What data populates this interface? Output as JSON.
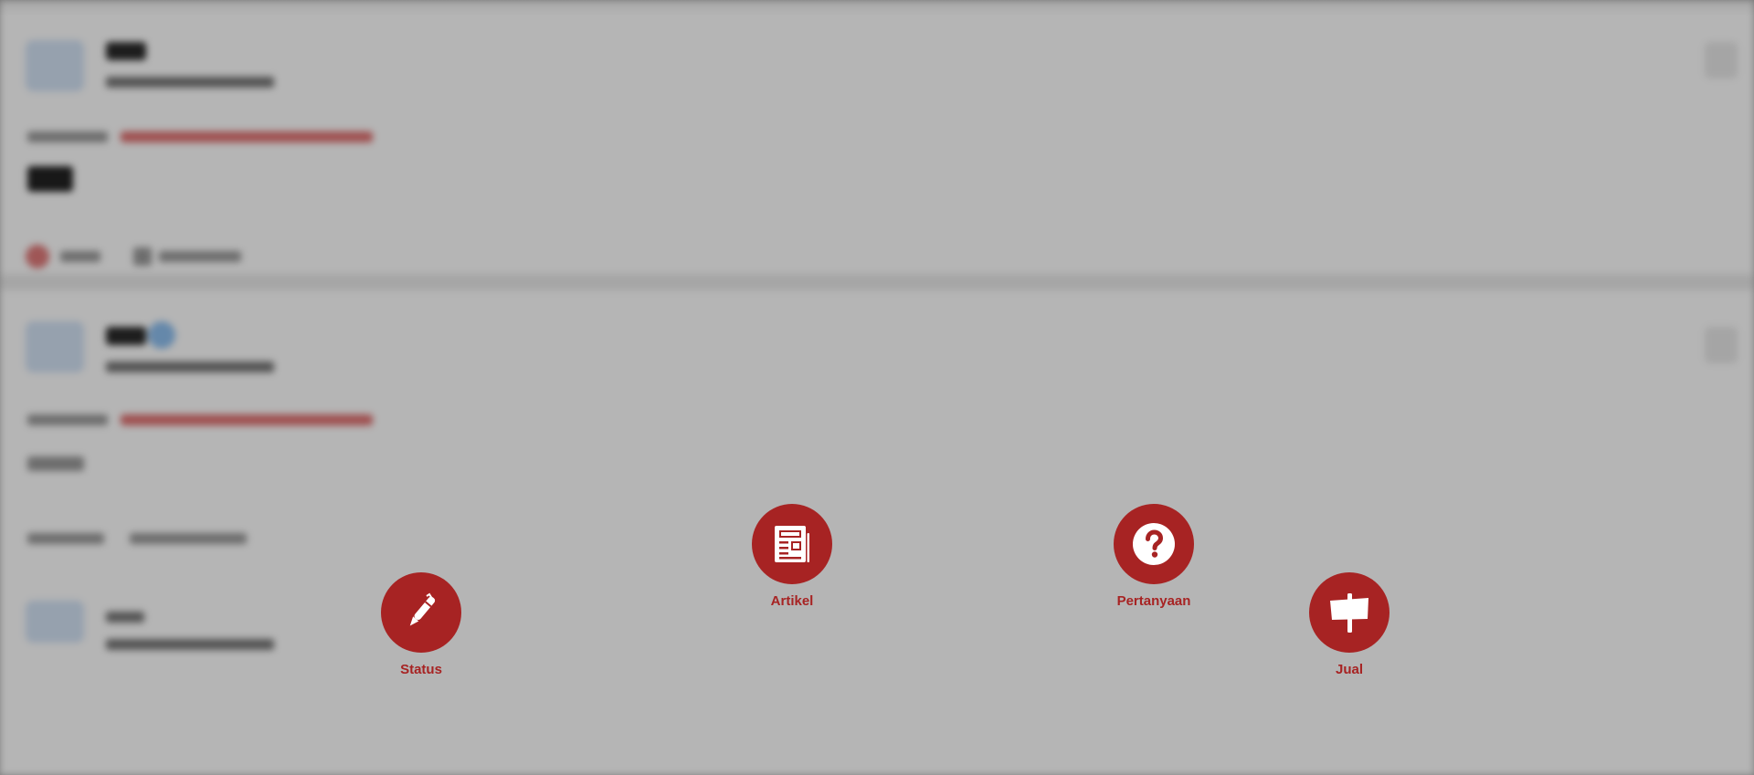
{
  "theme": {
    "accent": "#a72323",
    "overlay": "rgba(0,0,0,0.29)"
  },
  "create_menu": {
    "items": [
      {
        "key": "status",
        "label": "Status",
        "icon": "pen-icon"
      },
      {
        "key": "artikel",
        "label": "Artikel",
        "icon": "newspaper-icon"
      },
      {
        "key": "pertanyaan",
        "label": "Pertanyaan",
        "icon": "question-icon"
      },
      {
        "key": "jual",
        "label": "Jual",
        "icon": "signboard-icon"
      }
    ]
  }
}
